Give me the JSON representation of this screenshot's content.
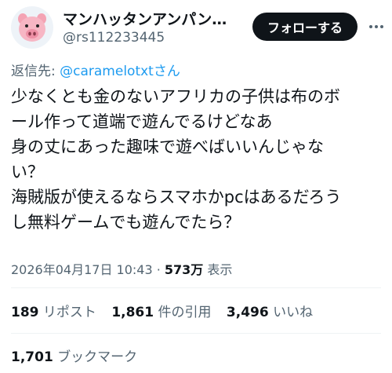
{
  "author": {
    "display_name": "マンハッタンアンパン…",
    "handle": "@rs112233445",
    "avatar_icon": "pig-face-icon"
  },
  "follow_button": {
    "label": "フォローする"
  },
  "reply_to": {
    "prefix": "返信先: ",
    "target": "@caramelotxtさん"
  },
  "tweet": {
    "lines": [
      "少なくとも金のないアフリカの子供は布のボ",
      "ール作って道端で遊んでるけどなあ",
      "身の丈にあった趣味で遊べばいいんじゃな",
      "い？",
      "海賊版が使えるならスマホかpcはあるだろう",
      "し無料ゲームでも遊んでたら？"
    ]
  },
  "meta": {
    "timestamp": "2026年04月17日 10:43",
    "separator": " · ",
    "views_count": "573万",
    "views_label": " 表示"
  },
  "stats": {
    "reposts": {
      "count": "189",
      "label": "リポスト"
    },
    "quotes": {
      "count": "1,861",
      "label": "件の引用"
    },
    "likes": {
      "count": "3,496",
      "label": "いいね"
    },
    "bookmarks": {
      "count": "1,701",
      "label": "ブックマーク"
    }
  },
  "colors": {
    "accent": "#1d9bf0",
    "text": "#0f1419",
    "muted": "#536471",
    "border": "#eff3f4"
  }
}
